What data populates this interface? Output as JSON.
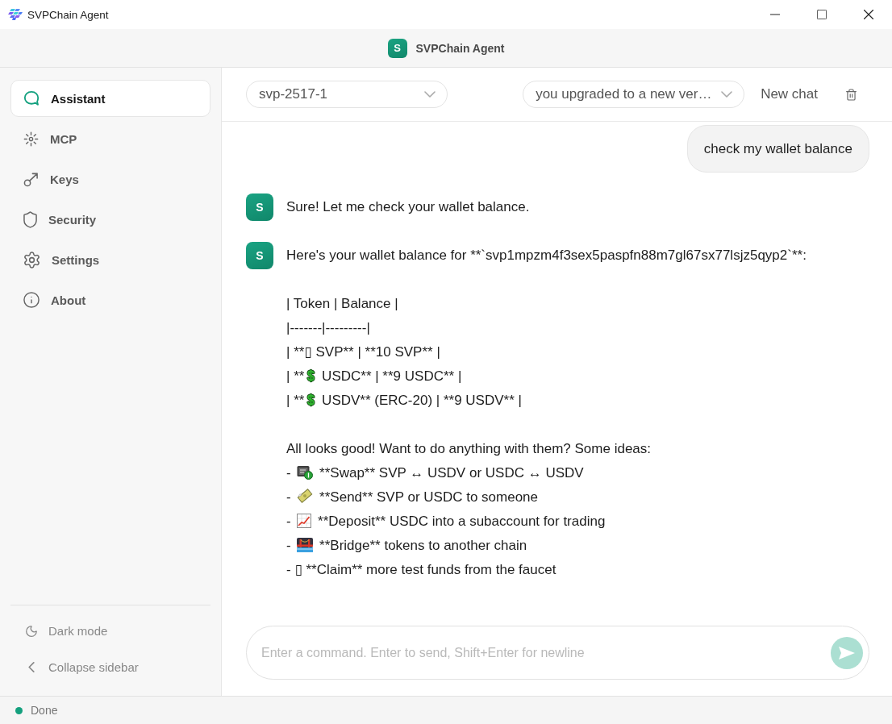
{
  "window": {
    "title": "SVPChain Agent"
  },
  "header": {
    "logo_letter": "S",
    "title": "SVPChain Agent"
  },
  "sidebar": {
    "items": [
      {
        "label": "Assistant",
        "selected": true
      },
      {
        "label": "MCP",
        "selected": false
      },
      {
        "label": "Keys",
        "selected": false
      },
      {
        "label": "Security",
        "selected": false
      },
      {
        "label": "Settings",
        "selected": false
      },
      {
        "label": "About",
        "selected": false
      }
    ],
    "footer_items": [
      {
        "label": "Dark mode"
      },
      {
        "label": "Collapse sidebar"
      }
    ]
  },
  "toolbar": {
    "model_select": {
      "value": "svp-2517-1"
    },
    "chat_select": {
      "value": "you upgraded to a new ver…"
    },
    "new_chat_button": "New chat"
  },
  "messages": [
    {
      "kind": "user",
      "text": "check my wallet balance"
    },
    {
      "kind": "assistant",
      "avatar": "S",
      "lines": [
        {
          "kind": "text",
          "text": "Sure! Let me check your wallet balance."
        }
      ]
    },
    {
      "kind": "assistant",
      "avatar": "S",
      "lines": [
        {
          "kind": "text",
          "text": "Here's your wallet balance for **`svp1mpzm4f3sex5paspfn88m7gl67sx77lsjz5qyp2`**:"
        },
        {
          "kind": "blank"
        },
        {
          "kind": "text",
          "text": "| Token | Balance |"
        },
        {
          "kind": "text",
          "text": "|-------|---------|"
        },
        {
          "kind": "text",
          "text": "| **▯ SVP** | **10 SVP** |"
        },
        {
          "kind": "dollar",
          "before": "| **",
          "after": " USDC** | **9 USDC** |"
        },
        {
          "kind": "dollar",
          "before": "| **",
          "after": " USDV** (ERC-20) | **9 USDV** |"
        },
        {
          "kind": "blank"
        },
        {
          "kind": "text",
          "text": "All looks good! Want to do anything with them? Some ideas:"
        },
        {
          "kind": "exchange",
          "before": "- ",
          "after": " **Swap** SVP ↔ USDV or USDC ↔ USDV"
        },
        {
          "kind": "banknote",
          "before": "- ",
          "after": " **Send** SVP or USDC to someone"
        },
        {
          "kind": "chart",
          "before": "- ",
          "after": " **Deposit** USDC into a subaccount for trading"
        },
        {
          "kind": "bridge",
          "before": "- ",
          "after": " **Bridge** tokens to another chain"
        },
        {
          "kind": "text",
          "text": "- ▯ **Claim** more test funds from the faucet"
        }
      ]
    }
  ],
  "composer": {
    "placeholder": "Enter a command. Enter to send, Shift+Enter for newline",
    "send_disabled": true
  },
  "status_bar": {
    "text": "Done"
  }
}
